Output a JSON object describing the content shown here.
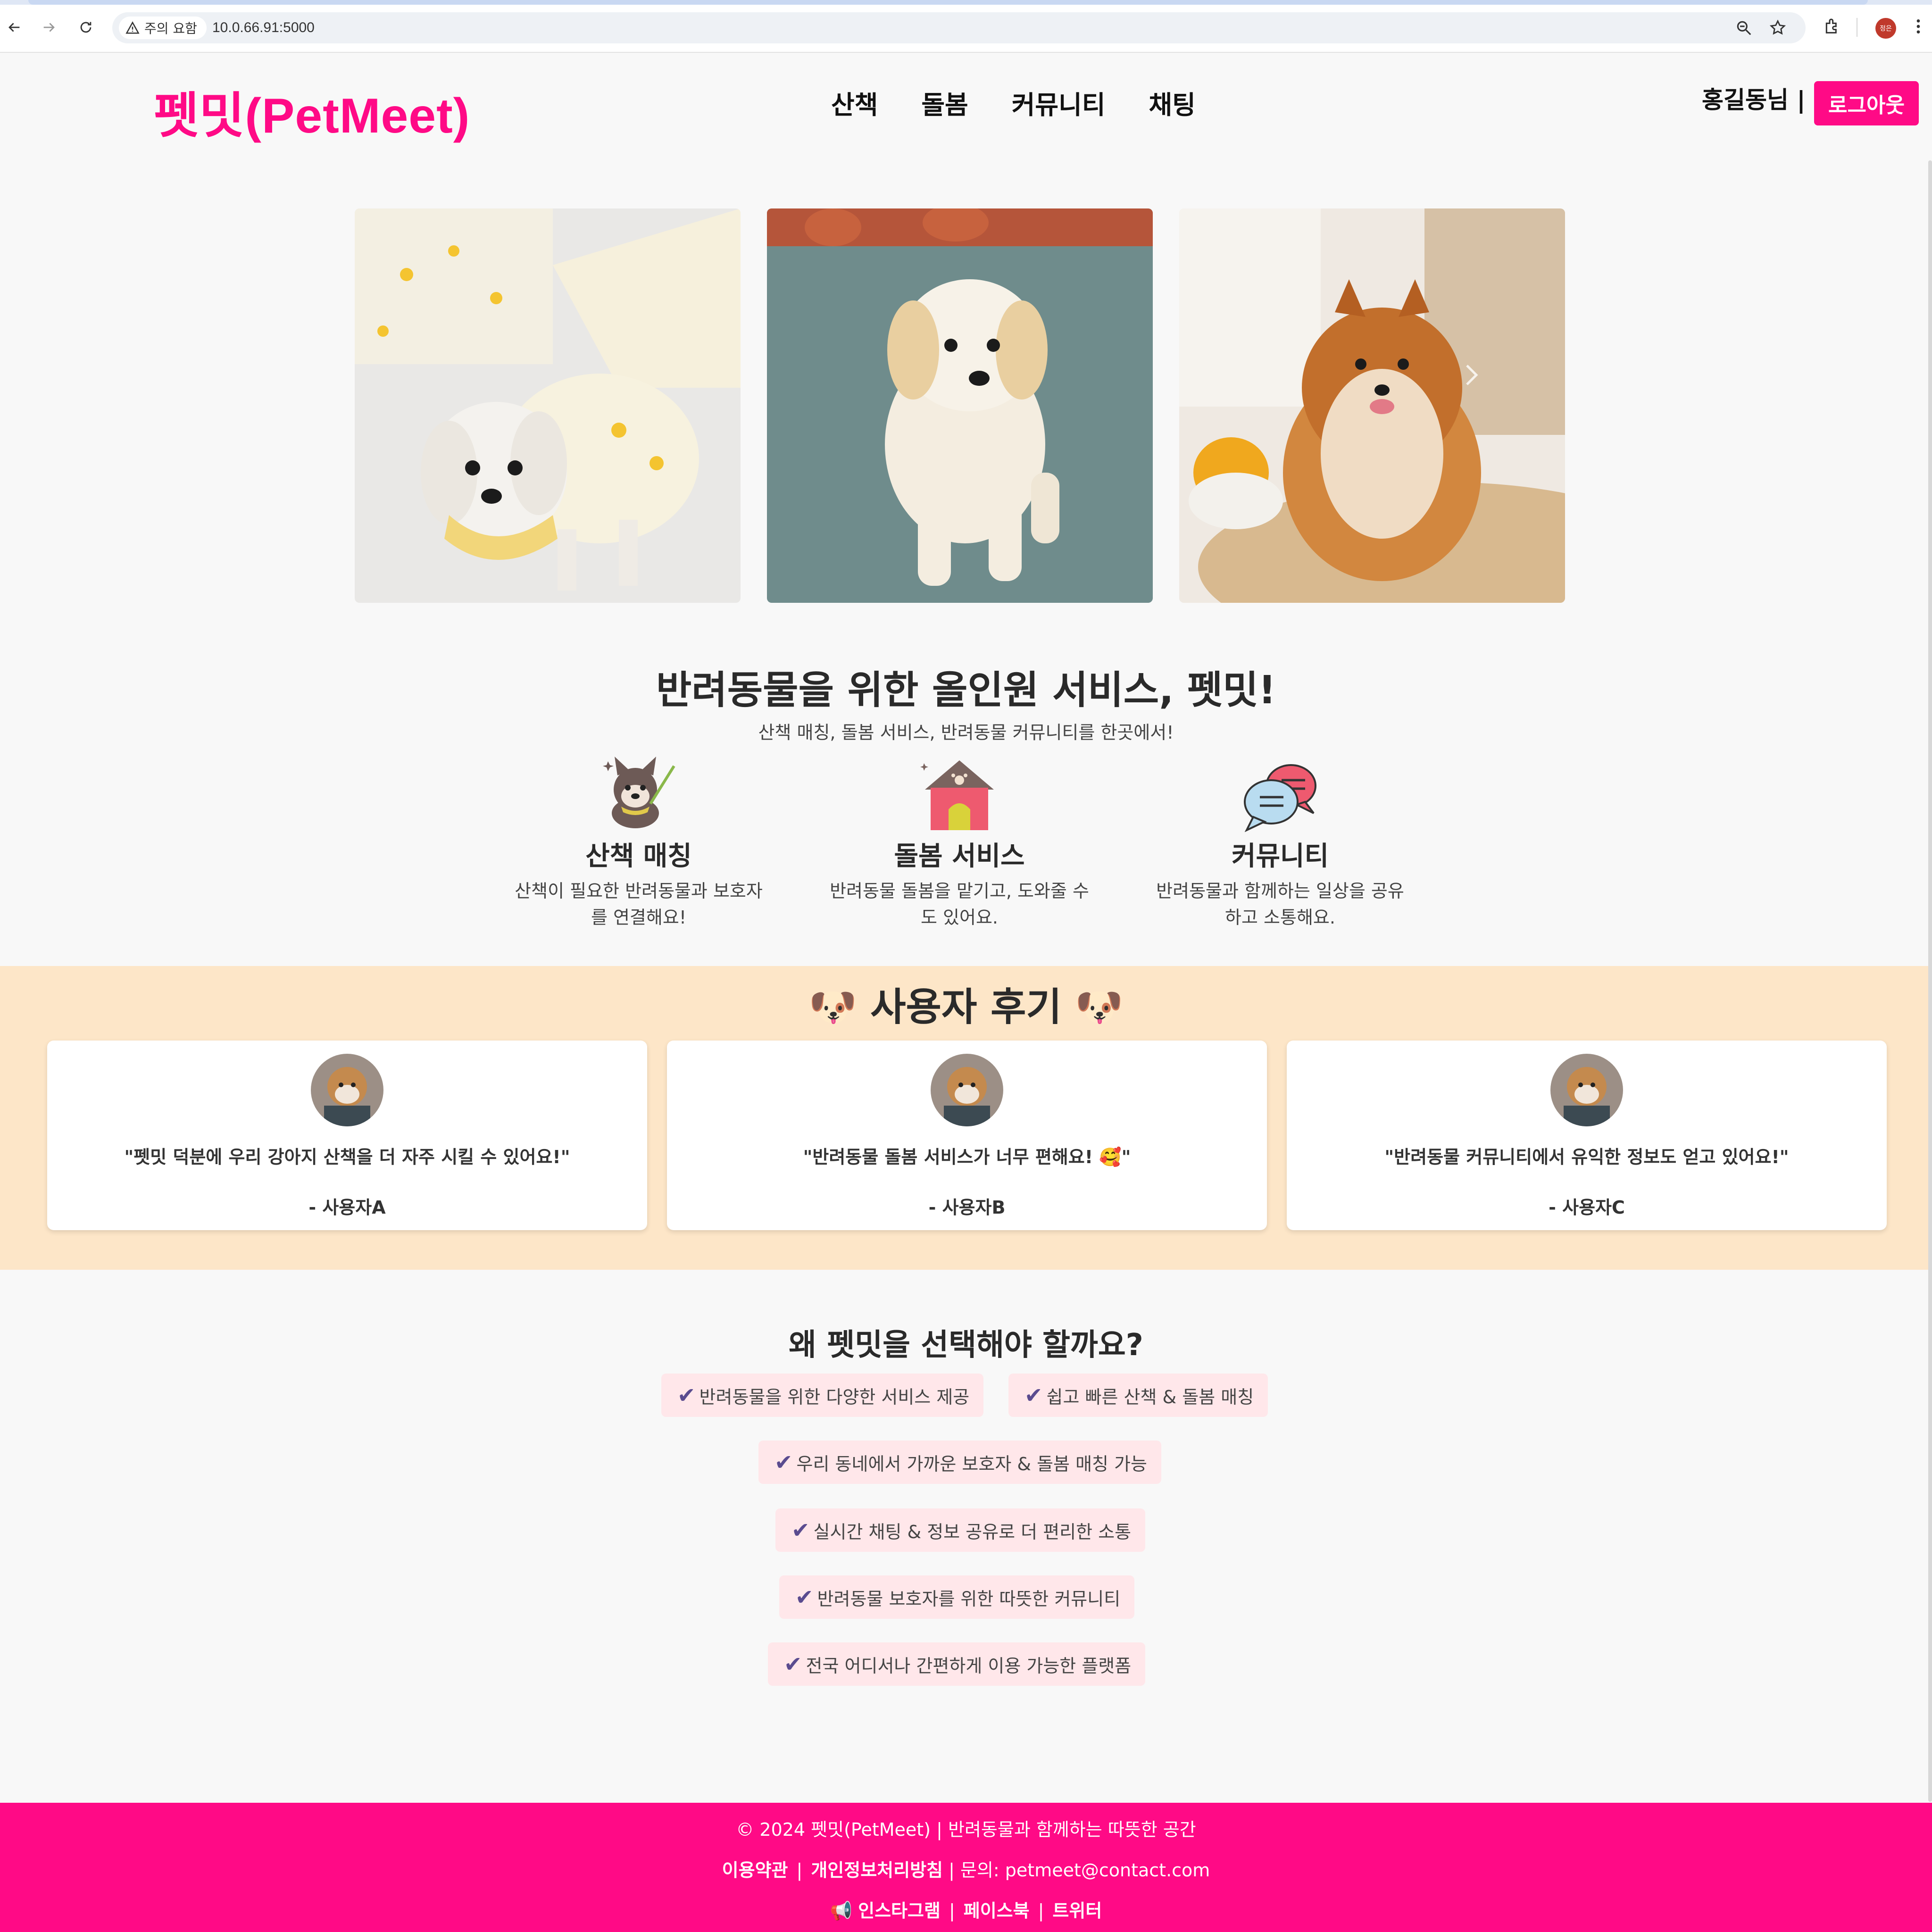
{
  "browser": {
    "security_label": "주의 요함",
    "url": "10.0.66.91:5000",
    "profile_initial": "정은"
  },
  "header": {
    "logo": "펫밋(PetMeet)",
    "nav": [
      "산책",
      "돌봄",
      "커뮤니티",
      "채팅"
    ],
    "user_greeting": "홍길동님 |",
    "logout_label": "로그아웃"
  },
  "intro": {
    "title": "반려동물을 위한 올인원 서비스, 펫밋!",
    "subtitle": "산책 매칭, 돌봄 서비스, 반려동물 커뮤니티를 한곳에서!",
    "features": [
      {
        "name": "산책 매칭",
        "desc_line1": "산책이 필요한 반려동물과 보호자",
        "desc_line2": "를 연결해요!",
        "icon": "walking-dog-icon"
      },
      {
        "name": "돌봄 서비스",
        "desc_line1": "반려동물 돌봄을 맡기고, 도와줄 수",
        "desc_line2": "도 있어요.",
        "icon": "dog-house-icon"
      },
      {
        "name": "커뮤니티",
        "desc_line1": "반려동물과 함께하는 일상을 공유",
        "desc_line2": "하고 소통해요.",
        "icon": "chat-bubbles-icon"
      }
    ]
  },
  "reviews": {
    "title": "🐶 사용자 후기 🐶",
    "items": [
      {
        "text": "\"펫밋 덕분에 우리 강아지 산책을 더 자주 시킬 수 있어요!\"",
        "author": "- 사용자A"
      },
      {
        "text": "\"반려동물 돌봄 서비스가 너무 편해요! 🥰\"",
        "author": "- 사용자B"
      },
      {
        "text": "\"반려동물 커뮤니티에서 유익한 정보도 얻고 있어요!\"",
        "author": "- 사용자C"
      }
    ]
  },
  "why": {
    "title": "왜 펫밋을 선택해야 할까요?",
    "items": [
      "반려동물을 위한 다양한 서비스 제공",
      "쉽고 빠른 산책 & 돌봄 매칭",
      "우리 동네에서 가까운 보호자 & 돌봄 매칭 가능",
      "실시간 채팅 & 정보 공유로 더 편리한 소통",
      "반려동물 보호자를 위한 따뜻한 커뮤니티",
      "전국 어디서나 간편하게 이용 가능한 플랫폼"
    ]
  },
  "footer": {
    "copyright": "© 2024 펫밋(PetMeet) | 반려동물과 함께하는 따뜻한 공간",
    "terms": "이용약관",
    "privacy": "개인정보처리방침",
    "contact": "| 문의: petmeet@contact.com",
    "instagram": "인스타그램",
    "facebook": "페이스북",
    "twitter": "트위터"
  },
  "colors": {
    "brand": "#ff0a86",
    "reviews_bg": "#fde6c8",
    "why_item_bg": "#ffe7ea",
    "check": "#5a4b8f"
  }
}
